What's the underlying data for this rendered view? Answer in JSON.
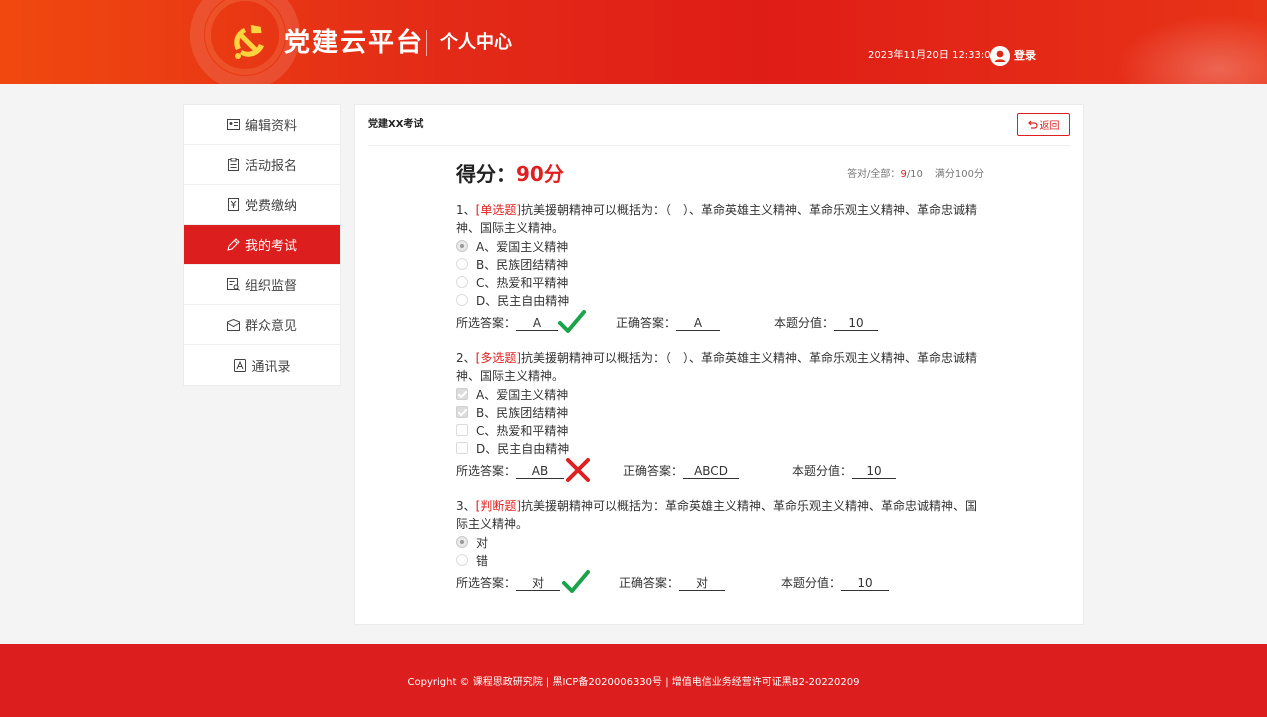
{
  "header": {
    "brand": "党建云平台",
    "subtitle": "个人中心",
    "datetime": "2023年11月20日 12:33:00",
    "login_label": "登录"
  },
  "sidebar": {
    "items": [
      {
        "label": "编辑资料",
        "icon": "id-card-icon"
      },
      {
        "label": "活动报名",
        "icon": "clipboard-icon"
      },
      {
        "label": "党费缴纳",
        "icon": "payment-icon"
      },
      {
        "label": "我的考试",
        "icon": "pen-icon",
        "active": true
      },
      {
        "label": "组织监督",
        "icon": "inspect-icon"
      },
      {
        "label": "群众意见",
        "icon": "message-icon"
      },
      {
        "label": "通讯录",
        "icon": "contacts-icon"
      }
    ]
  },
  "panel": {
    "title": "党建XX考试",
    "back_label": "返回"
  },
  "score": {
    "label": "得分：",
    "value": "90分",
    "meta_prefix": "答对/全部：",
    "correct": "9",
    "total": "/10",
    "full_mark": "满分100分"
  },
  "questions": [
    {
      "number": "1、",
      "tag": "[单选题]",
      "text": "抗美援朝精神可以概括为：（　）、革命英雄主义精神、革命乐观主义精神、革命忠诚精神、国际主义精神。",
      "type": "radio",
      "options": [
        "A、爱国主义精神",
        "B、民族团结精神",
        "C、热爱和平精神",
        "D、民主自由精神"
      ],
      "checked": [
        true,
        false,
        false,
        false
      ],
      "selected_label": "所选答案：",
      "selected": "A",
      "correct_label": "正确答案：",
      "correct": "A",
      "score_label": "本题分值：",
      "score": "10",
      "result": "correct"
    },
    {
      "number": "2、",
      "tag": "[多选题]",
      "text": "抗美援朝精神可以概括为：（　）、革命英雄主义精神、革命乐观主义精神、革命忠诚精神、国际主义精神。",
      "type": "checkbox",
      "options": [
        "A、爱国主义精神",
        "B、民族团结精神",
        "C、热爱和平精神",
        "D、民主自由精神"
      ],
      "checked": [
        true,
        true,
        false,
        false
      ],
      "selected_label": "所选答案：",
      "selected": "AB",
      "correct_label": "正确答案：",
      "correct": "ABCD",
      "score_label": "本题分值：",
      "score": "10",
      "result": "wrong"
    },
    {
      "number": "3、",
      "tag": "[判断题]",
      "text": "抗美援朝精神可以概括为：革命英雄主义精神、革命乐观主义精神、革命忠诚精神、国际主义精神。",
      "type": "radio",
      "options": [
        "对",
        "错"
      ],
      "checked": [
        true,
        false
      ],
      "selected_label": "所选答案：",
      "selected": "对",
      "correct_label": "正确答案：",
      "correct": "对",
      "score_label": "本题分值：",
      "score": "10",
      "result": "correct"
    }
  ],
  "footer": {
    "text": "Copyright © 课程思政研究院 | 黑ICP备2020006330号 | 增值电信业务经营许可证黑B2-20220209"
  },
  "colors": {
    "brand_red": "#dd1e1e",
    "correct_green": "#1aa34a",
    "wrong_red": "#e02020"
  }
}
